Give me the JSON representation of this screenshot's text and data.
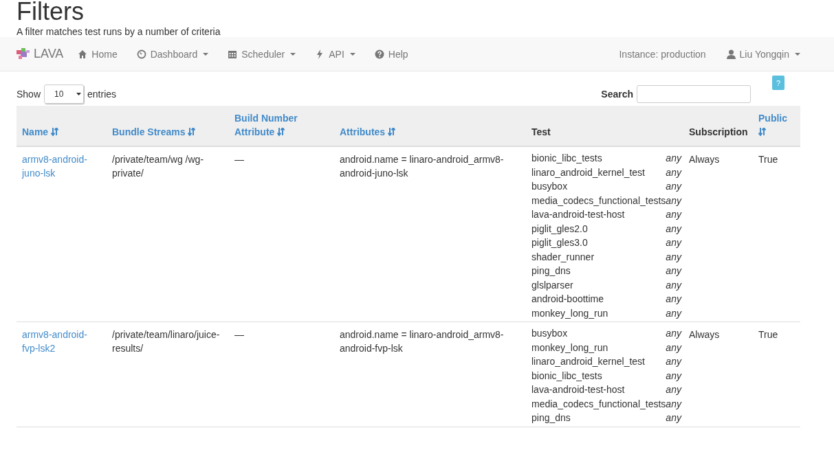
{
  "page": {
    "title": "Filters",
    "subtitle": "A filter matches test runs by a number of criteria"
  },
  "navbar": {
    "brand": "LAVA",
    "items": [
      {
        "label": "Home",
        "dropdown": false
      },
      {
        "label": "Dashboard",
        "dropdown": true
      },
      {
        "label": "Scheduler",
        "dropdown": true
      },
      {
        "label": "API",
        "dropdown": true
      },
      {
        "label": "Help",
        "dropdown": false
      }
    ],
    "instance": "Instance: production",
    "user": "Liu Yongqin"
  },
  "controls": {
    "show_label": "Show",
    "page_size": "10",
    "entries_label": "entries",
    "search_label": "Search",
    "help": "?"
  },
  "table": {
    "columns": [
      {
        "label": "Name",
        "sortable": true
      },
      {
        "label": "Bundle Streams",
        "sortable": true
      },
      {
        "label": "Build Number Attribute",
        "sortable": true
      },
      {
        "label": "Attributes",
        "sortable": true
      },
      {
        "label": "Test",
        "sortable": false
      },
      {
        "label": "Subscription",
        "sortable": false
      },
      {
        "label": "Public",
        "sortable": true
      }
    ],
    "rows": [
      {
        "name": "armv8-android-juno-lsk",
        "bundle_streams": "/private/team/wg /wg-private/",
        "build_number_attribute": "—",
        "attributes": "android.name = linaro-android_armv8-android-juno-lsk",
        "tests": [
          {
            "name": "bionic_libc_tests",
            "match": "any"
          },
          {
            "name": "linaro_android_kernel_test",
            "match": "any"
          },
          {
            "name": "busybox",
            "match": "any"
          },
          {
            "name": "media_codecs_functional_tests",
            "match": "any"
          },
          {
            "name": "lava-android-test-host",
            "match": "any"
          },
          {
            "name": "piglit_gles2.0",
            "match": "any"
          },
          {
            "name": "piglit_gles3.0",
            "match": "any"
          },
          {
            "name": "shader_runner",
            "match": "any"
          },
          {
            "name": "ping_dns",
            "match": "any"
          },
          {
            "name": "glslparser",
            "match": "any"
          },
          {
            "name": "android-boottime",
            "match": "any"
          },
          {
            "name": "monkey_long_run",
            "match": "any"
          }
        ],
        "subscription": "Always",
        "public": "True"
      },
      {
        "name": "armv8-android-fvp-lsk2",
        "bundle_streams": "/private/team/linaro/juice-results/",
        "build_number_attribute": "—",
        "attributes": "android.name = linaro-android_armv8-android-fvp-lsk",
        "tests": [
          {
            "name": "busybox",
            "match": "any"
          },
          {
            "name": "monkey_long_run",
            "match": "any"
          },
          {
            "name": "linaro_android_kernel_test",
            "match": "any"
          },
          {
            "name": "bionic_libc_tests",
            "match": "any"
          },
          {
            "name": "lava-android-test-host",
            "match": "any"
          },
          {
            "name": "media_codecs_functional_tests",
            "match": "any"
          },
          {
            "name": "ping_dns",
            "match": "any"
          }
        ],
        "subscription": "Always",
        "public": "True"
      }
    ]
  }
}
